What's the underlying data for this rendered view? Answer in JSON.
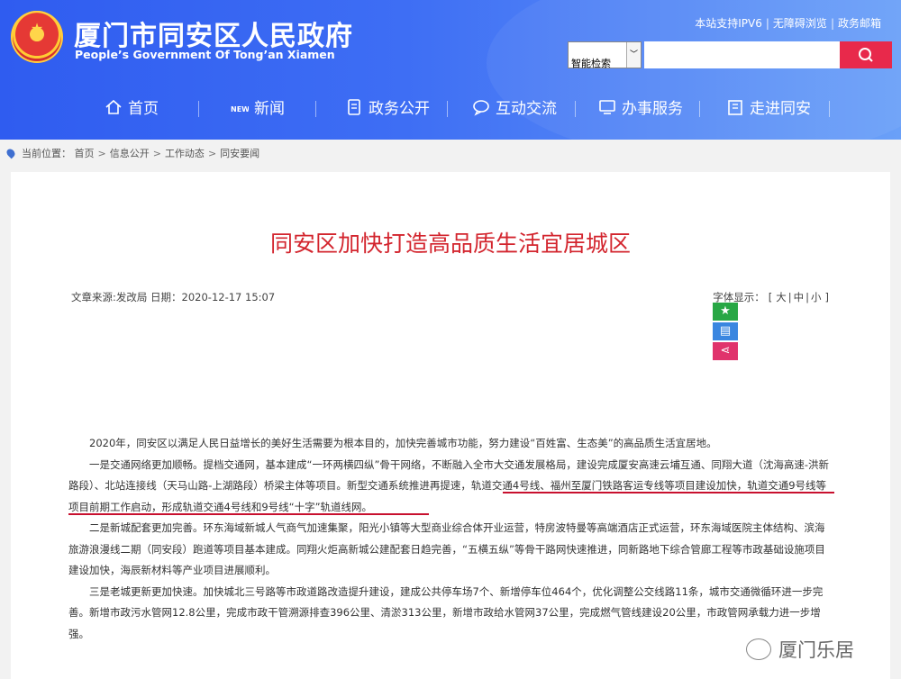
{
  "header": {
    "title": "厦门市同安区人民政府",
    "subtitle": "People’s Government Of Tong’an Xiamen",
    "top_links": [
      "本站支持IPV6",
      "无障碍浏览",
      "政务邮箱"
    ],
    "search": {
      "select_value": "智能检索",
      "input_value": ""
    }
  },
  "nav": {
    "items": [
      {
        "label": "首页",
        "icon": "home-icon"
      },
      {
        "label": "新闻",
        "icon": "news-icon"
      },
      {
        "label": "政务公开",
        "icon": "document-icon"
      },
      {
        "label": "互动交流",
        "icon": "chat-icon"
      },
      {
        "label": "办事服务",
        "icon": "screen-icon"
      },
      {
        "label": "走进同安",
        "icon": "building-icon"
      }
    ]
  },
  "breadcrumb": {
    "prefix": "当前位置：",
    "items": [
      "首页",
      "信息公开",
      "工作动态",
      "同安要闻"
    ]
  },
  "article": {
    "title": "同安区加快打造高品质生活宜居城区",
    "meta": "文章来源:发改局 日期：2020-12-17 15:07",
    "font_size_label": "字体显示：",
    "font_sizes": [
      "大",
      "中",
      "小"
    ],
    "paragraphs": [
      "2020年，同安区以满足人民日益增长的美好生活需要为根本目的，加快完善城市功能，努力建设“百姓富、生态美”的高品质生活宜居地。",
      "一是交通网络更加顺畅。提档交通网，基本建成“一环两横四纵”骨干网络，不断融入全市大交通发展格局，建设完成厦安高速云埔互通、同翔大道（沈海高速-洪新路段）、北站连接线（天马山路-上湖路段）桥梁主体等项目。新型交通系统推进再提速，轨道交通4号线、福州至厦门铁路客运专线等项目建设加快，轨道交通9号线等项目前期工作启动，形成轨道交通4号线和9号线“十字”轨道线网。",
      "二是新城配套更加完善。环东海域新城人气商气加速集聚，阳光小镇等大型商业综合体开业运营，特房波特曼等高端酒店正式运营，环东海域医院主体结构、滨海旅游浪漫线二期（同安段）跑道等项目基本建成。同翔火炬高新城公建配套日趋完善，“五横五纵”等骨干路网快速推进，同新路地下综合管廊工程等市政基础设施项目建设加快，海辰新材料等产业项目进展顺利。",
      "三是老城更新更加快速。加快城北三号路等市政道路改造提升建设，建成公共停车场7个、新增停车位464个，优化调整公交线路11条，城市交通微循环进一步完善。新增市政污水管网12.8公里，完成市政干管溯源排查396公里、清淤313公里，新增市政给水管网37公里，完成燃气管线建设20公里，市政管网承载力进一步增强。"
    ]
  },
  "watermark": "厦门乐居",
  "colors": {
    "header_blue": "#3a67f2",
    "title_red": "#d3252e",
    "search_red": "#e8294b",
    "underline_red": "#c8102e"
  }
}
